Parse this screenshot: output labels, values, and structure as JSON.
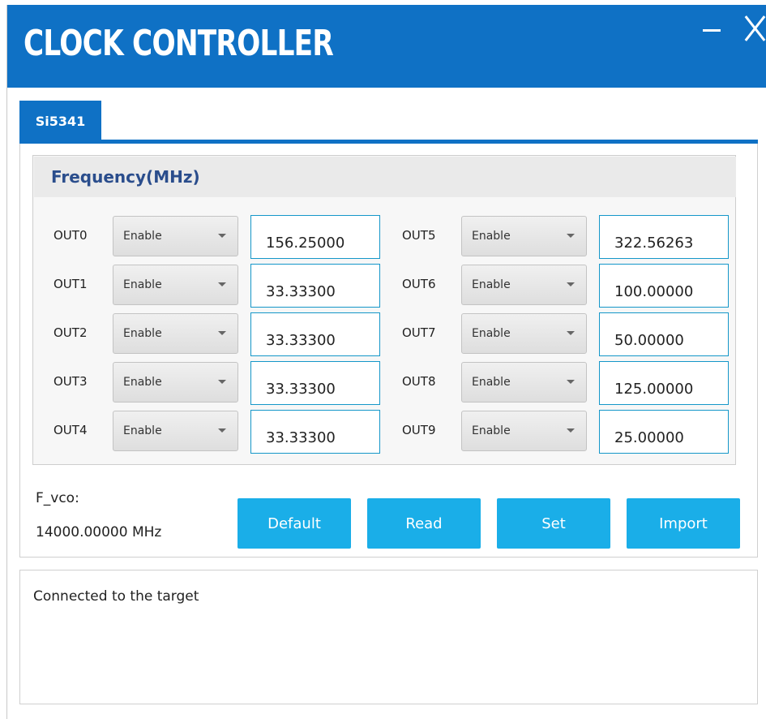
{
  "window": {
    "title": "CLOCK CONTROLLER",
    "minimize_glyph": "–",
    "close_glyph": "✕"
  },
  "tabs": [
    {
      "label": "Si5341",
      "selected": true
    }
  ],
  "frequency": {
    "title": "Frequency(MHz)",
    "outputs": [
      {
        "label": "OUT0",
        "mode": "Enable",
        "value": "156.25000"
      },
      {
        "label": "OUT1",
        "mode": "Enable",
        "value": "33.33300"
      },
      {
        "label": "OUT2",
        "mode": "Enable",
        "value": "33.33300"
      },
      {
        "label": "OUT3",
        "mode": "Enable",
        "value": "33.33300"
      },
      {
        "label": "OUT4",
        "mode": "Enable",
        "value": "33.33300"
      },
      {
        "label": "OUT5",
        "mode": "Enable",
        "value": "322.56263"
      },
      {
        "label": "OUT6",
        "mode": "Enable",
        "value": "100.00000"
      },
      {
        "label": "OUT7",
        "mode": "Enable",
        "value": "50.00000"
      },
      {
        "label": "OUT8",
        "mode": "Enable",
        "value": "125.00000"
      },
      {
        "label": "OUT9",
        "mode": "Enable",
        "value": "25.00000"
      }
    ]
  },
  "fvco": {
    "label": "F_vco:",
    "value": "14000.00000 MHz"
  },
  "buttons": {
    "default": "Default",
    "read": "Read",
    "set": "Set",
    "import": "Import"
  },
  "console": {
    "message": "Connected to the target"
  },
  "colors": {
    "title_bar": "#0f71c5",
    "button": "#1aaee8",
    "field_border": "#1597c9",
    "section_title": "#2a4d8c"
  }
}
